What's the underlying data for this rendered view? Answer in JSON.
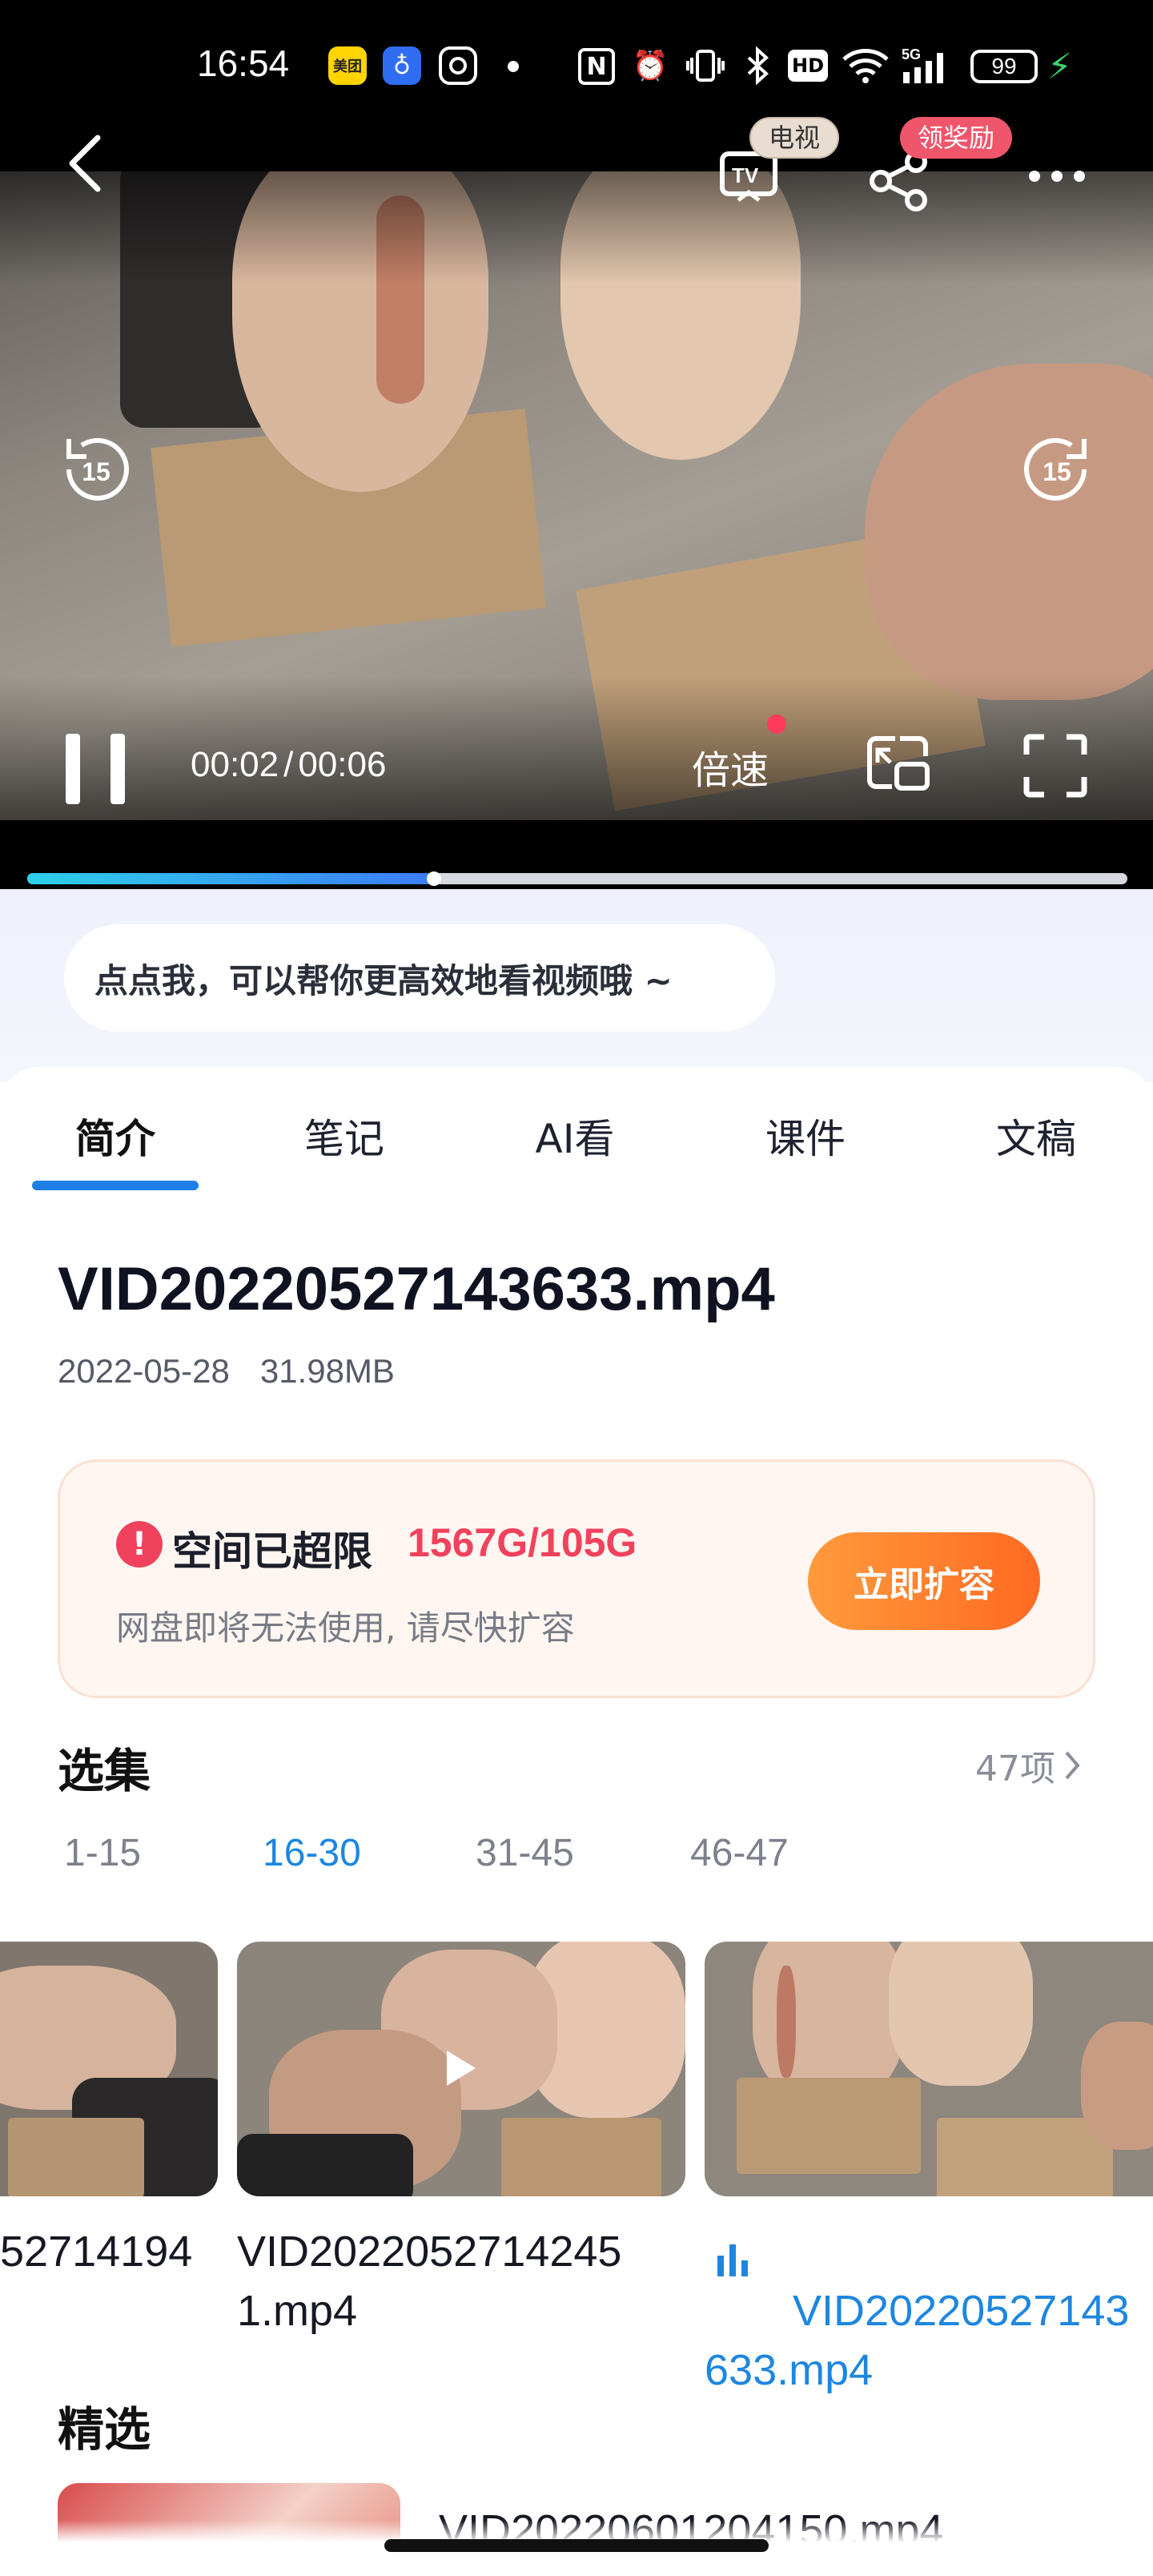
{
  "status_bar": {
    "time": "16:54",
    "icons": [
      "meituan-app-icon",
      "baidu-app-icon",
      "instagram-icon",
      "nfc-icon",
      "alarm-icon",
      "vibrate-icon",
      "bluetooth-icon",
      "hd-icon",
      "wifi-icon",
      "signal-5g-icon"
    ],
    "battery": "99",
    "app1": "美团"
  },
  "player": {
    "tv_badge": "电视",
    "reward_badge": "领奖励",
    "seek_back": "15",
    "seek_forward": "15",
    "current_time": "00:02",
    "duration": "00:06",
    "time_separator": "/",
    "speed_label": "倍速",
    "progress": 0.37
  },
  "assistant_tip": "点点我，可以帮你更高效地看视频哦 ~",
  "tabs": [
    {
      "label": "简介",
      "active": true
    },
    {
      "label": "笔记"
    },
    {
      "label": "AI看"
    },
    {
      "label": "课件"
    },
    {
      "label": "文稿"
    }
  ],
  "file": {
    "title": "VID20220527143633.mp4",
    "date": "2022-05-28",
    "size": "31.98MB"
  },
  "quota": {
    "title": "空间已超限",
    "usage": "1567G/105G",
    "subtitle": "网盘即将无法使用, 请尽快扩容",
    "button": "立即扩容"
  },
  "episodes": {
    "title": "选集",
    "count": "47项",
    "ranges": [
      "1-15",
      "16-30",
      "31-45",
      "46-47"
    ],
    "active_range": 1,
    "items": [
      {
        "name": "52714194"
      },
      {
        "name": "VID2022052714245\n1.mp4"
      },
      {
        "name": "VID20220527143\n633.mp4",
        "playing": true
      }
    ]
  },
  "featured": {
    "title": "精选",
    "first_item": "VID20220601204150.mp4"
  },
  "colors": {
    "accent": "#1d86e0",
    "alert": "#f0425c",
    "cta": "#ff7a2a"
  }
}
